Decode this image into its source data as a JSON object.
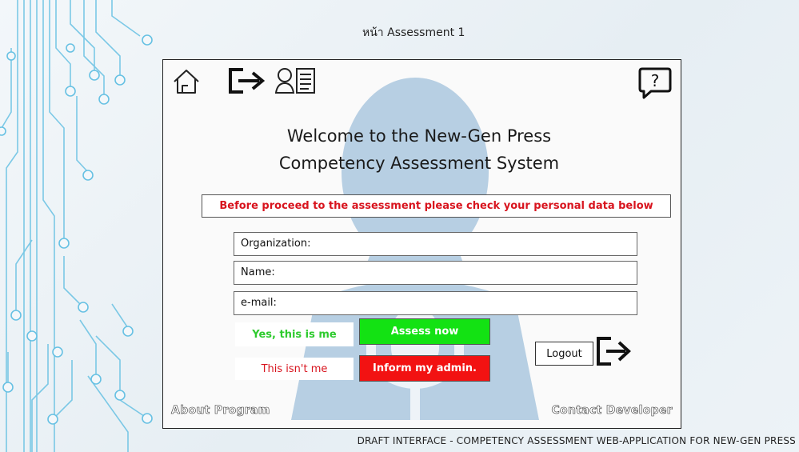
{
  "page_label": "หน้า Assessment 1",
  "header": {
    "welcome_line1": "Welcome to the New-Gen Press",
    "welcome_line2": "Competency Assessment System"
  },
  "notice": "Before proceed to the assessment please check your personal data below",
  "fields": {
    "organization": "Organization:",
    "name": "Name:",
    "email": "e-mail:"
  },
  "buttons": {
    "yes": "Yes, this is me",
    "assess": "Assess now",
    "not_me": "This isn't me",
    "inform": "Inform my admin.",
    "logout": "Logout"
  },
  "links": {
    "about": "About Program",
    "contact": "Contact Developer"
  },
  "footer": "DRAFT INTERFACE - COMPETENCY ASSESSMENT WEB-APPLICATION FOR NEW-GEN PRESS",
  "icons": {
    "home": "home-icon",
    "exit": "exit-arrow-icon",
    "profile": "user-profile-icon",
    "help": "help-chat-icon",
    "logout": "logout-arrow-icon"
  },
  "colors": {
    "notice_text": "#d8141e",
    "assess_bg": "#13e213",
    "inform_bg": "#f21212",
    "yes_text": "#2ecb2e",
    "watermark": "#b7cfe3"
  }
}
